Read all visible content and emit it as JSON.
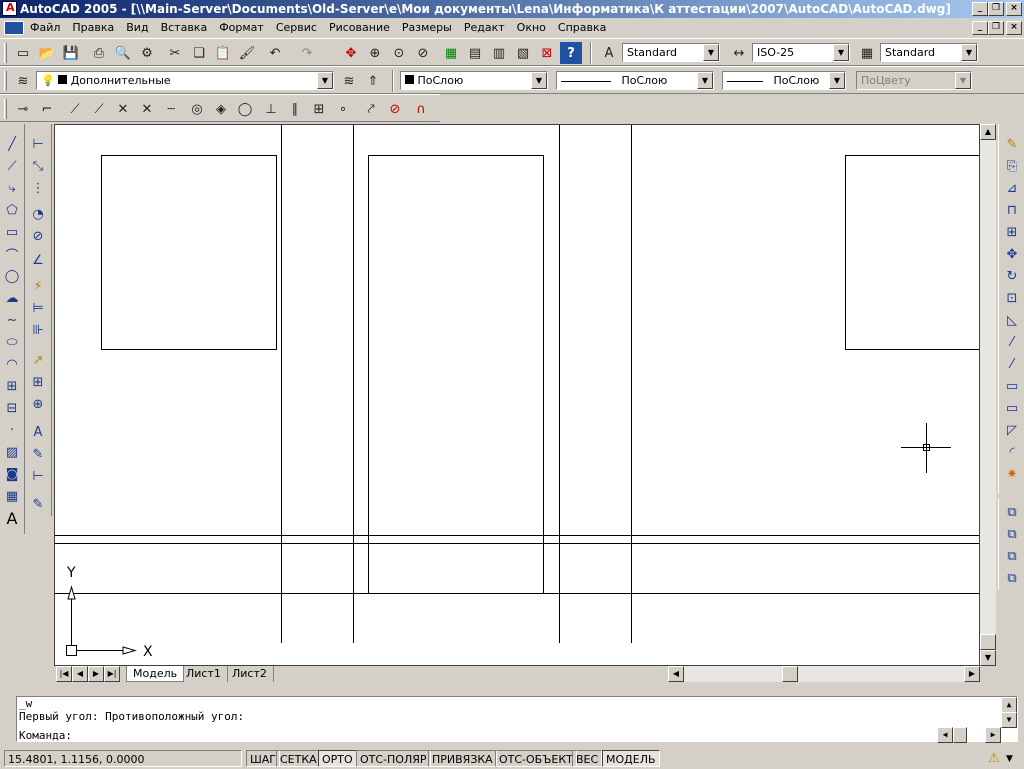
{
  "window": {
    "title": "AutoCAD 2005 - [\\\\Main-Server\\Documents\\Old-Server\\e\\Мои документы\\Lena\\Информатика\\К аттестации\\2007\\AutoCAD\\AutoCAD.dwg]"
  },
  "menu": [
    "Файл",
    "Правка",
    "Вид",
    "Вставка",
    "Формат",
    "Сервис",
    "Рисование",
    "Размеры",
    "Редакт",
    "Окно",
    "Справка"
  ],
  "toolbar": {
    "text_style": "Standard",
    "dim_style": "ISO-25",
    "table_style": "Standard",
    "layer": "Дополнительные",
    "color": "ПоСлою",
    "linetype": "ПоСлою",
    "lineweight": "ПоСлою",
    "plot_style": "ПоЦвету"
  },
  "layout_tabs": [
    "Модель",
    "Лист1",
    "Лист2"
  ],
  "ucs": {
    "x_label": "X",
    "y_label": "Y"
  },
  "command": {
    "history": [
      "_w",
      "Первый угол: Противоположный угол:"
    ],
    "prompt": "Команда:"
  },
  "status": {
    "coords": "15.4801, 1.1156, 0.0000",
    "toggles": [
      {
        "label": "ШАГ",
        "on": false
      },
      {
        "label": "СЕТКА",
        "on": false
      },
      {
        "label": "ОРТО",
        "on": true
      },
      {
        "label": "ОТС-ПОЛЯР",
        "on": false
      },
      {
        "label": "ПРИВЯЗКА",
        "on": false
      },
      {
        "label": "ОТС-ОБЪЕКТ",
        "on": false
      },
      {
        "label": "ВЕС",
        "on": false
      },
      {
        "label": "МОДЕЛЬ",
        "on": true
      }
    ]
  },
  "colors": {
    "title_start": "#0a246a",
    "title_end": "#a6caf0",
    "canvas": "#ffffff",
    "drawing": "#000000"
  }
}
